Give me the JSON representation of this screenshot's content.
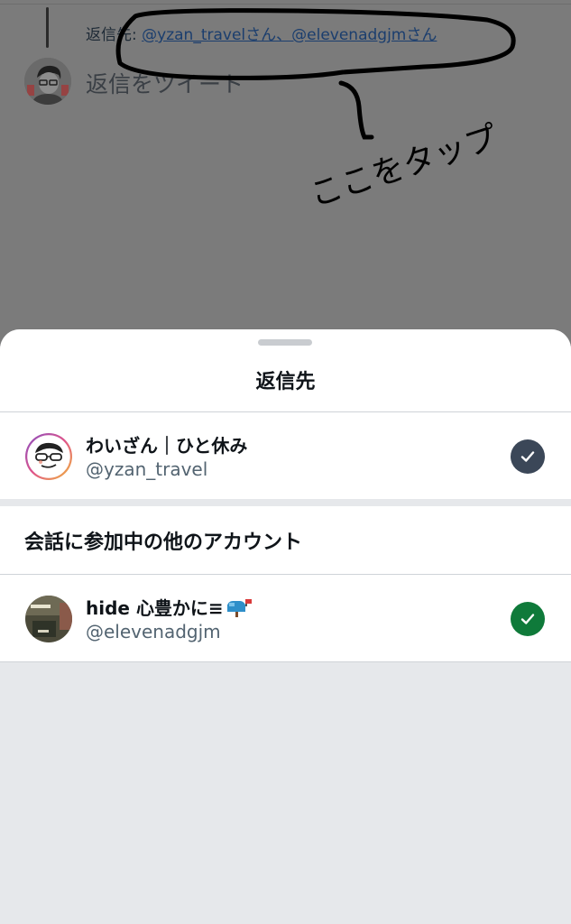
{
  "compose": {
    "reply_to_prefix": "返信先: ",
    "reply_to_handles": "@yzan_travelさん、@elevenadgjmさん",
    "placeholder": "返信をツイート"
  },
  "annotation": {
    "text": "ここをタップ"
  },
  "sheet": {
    "title": "返信先",
    "section_title": "会話に参加中の他のアカウント",
    "accounts": [
      {
        "name": "わいざん｜ひと休み",
        "handle": "@yzan_travel",
        "checked": true,
        "check_color": "#3b4758"
      },
      {
        "name": "hide 心豊かに≡",
        "name_emoji": "mailbox-icon",
        "handle": "@elevenadgjm",
        "checked": true,
        "check_color": "#0f7a3a"
      }
    ]
  },
  "colors": {
    "dim_backdrop": "#7b7b7b",
    "sheet_bg": "#ffffff",
    "sheet_lower_bg": "#e6e8eb",
    "link": "#1b3e6e"
  }
}
